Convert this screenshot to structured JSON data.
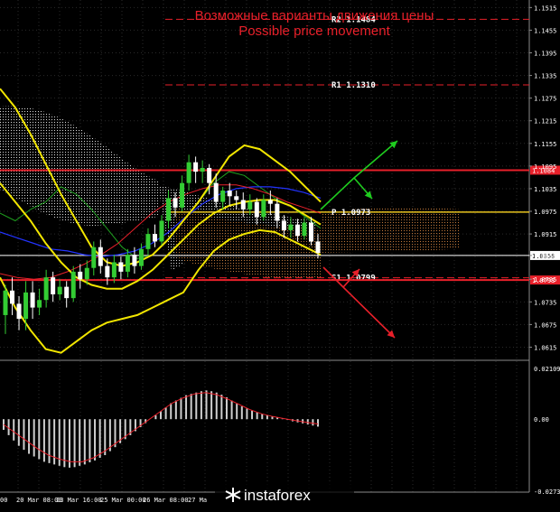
{
  "header": {
    "title_ru": "Возможные варианты движения цены",
    "title_en": "Possible price movement"
  },
  "colors": {
    "background": "#000000",
    "level_red": "#e8202a",
    "pivot_yellow": "#e6c21e",
    "bull_candle": "#33cc33",
    "bear_candle": "#ffffff",
    "bollinger": "#f2e600",
    "blue_ma": "#2233ff",
    "green_line": "#1fa01f",
    "red_ma": "#e8202a",
    "cloud_white": "#d9d9d9",
    "cloud_orange": "#c0783a",
    "arrow_up": "#1fcc1f",
    "arrow_down": "#e8202a",
    "macd_bar": "#cfcfcf",
    "signal": "#e8202a"
  },
  "chart_data": {
    "type": "candlestick",
    "price_axis": {
      "ylim": [
        1.0585,
        1.1535
      ],
      "ticks": [
        "1.1515",
        "1.1455",
        "1.1395",
        "1.1335",
        "1.1275",
        "1.1215",
        "1.1155",
        "1.1095",
        "1.1035",
        "1.0975",
        "1.0915",
        "1.0858",
        "1.0795",
        "1.0735",
        "1.0675",
        "1.0615"
      ]
    },
    "time_axis": {
      "labels": [
        "00",
        "20 Mar 08:00",
        "23 Mar 16:00",
        "25 Mar 00:00",
        "26 Mar 08:00",
        "27 Ma"
      ]
    },
    "levels": [
      {
        "name": "R2",
        "label": "R2 1.1484",
        "value": 1.1484,
        "style": "dash",
        "color": "#e8202a"
      },
      {
        "name": "R1",
        "label": "R1 1.1310",
        "value": 1.131,
        "style": "dash",
        "color": "#e8202a"
      },
      {
        "name": "resistance",
        "label": "1.1084",
        "value": 1.1084,
        "style": "solid",
        "color": "#e8202a"
      },
      {
        "name": "P",
        "label": "P 1.0973",
        "value": 1.0973,
        "style": "solid",
        "color": "#e6c21e"
      },
      {
        "name": "current",
        "label": "1.0858",
        "value": 1.0858,
        "style": "thin",
        "color": "#ffffff"
      },
      {
        "name": "S1",
        "label": "S1 1.0799",
        "value": 1.0799,
        "style": "dash",
        "color": "#e8202a"
      },
      {
        "name": "support",
        "label": "1.0793",
        "value": 1.0793,
        "style": "solid",
        "color": "#e8202a"
      }
    ],
    "candles": [
      [
        1.07,
        1.0765,
        1.065,
        1.078
      ],
      [
        1.0765,
        1.073,
        1.07,
        1.08
      ],
      [
        1.073,
        1.069,
        1.066,
        1.075
      ],
      [
        1.069,
        1.076,
        1.066,
        1.079
      ],
      [
        1.076,
        1.072,
        1.069,
        1.079
      ],
      [
        1.072,
        1.074,
        1.07,
        1.077
      ],
      [
        1.074,
        1.08,
        1.072,
        1.082
      ],
      [
        1.08,
        1.0755,
        1.0735,
        1.0815
      ],
      [
        1.0755,
        1.0775,
        1.074,
        1.0795
      ],
      [
        1.0775,
        1.0745,
        1.072,
        1.079
      ],
      [
        1.0745,
        1.0815,
        1.0735,
        1.083
      ],
      [
        1.0815,
        1.0795,
        1.077,
        1.0835
      ],
      [
        1.0795,
        1.0825,
        1.078,
        1.0845
      ],
      [
        1.0825,
        1.088,
        1.0805,
        1.0895
      ],
      [
        1.088,
        1.083,
        1.081,
        1.09
      ],
      [
        1.083,
        1.08,
        1.078,
        1.085
      ],
      [
        1.08,
        1.084,
        1.0785,
        1.086
      ],
      [
        1.084,
        1.0815,
        1.0795,
        1.0855
      ],
      [
        1.0815,
        1.086,
        1.08,
        1.0875
      ],
      [
        1.086,
        1.083,
        1.081,
        1.088
      ],
      [
        1.083,
        1.0875,
        1.082,
        1.089
      ],
      [
        1.0875,
        1.0915,
        1.086,
        1.093
      ],
      [
        1.0915,
        1.0895,
        1.088,
        1.094
      ],
      [
        1.0895,
        1.095,
        1.0885,
        1.0965
      ],
      [
        1.095,
        1.101,
        1.093,
        1.103
      ],
      [
        1.101,
        1.0985,
        1.096,
        1.1025
      ],
      [
        1.0985,
        1.105,
        1.0975,
        1.107
      ],
      [
        1.105,
        1.1105,
        1.103,
        1.1125
      ],
      [
        1.1105,
        1.108,
        1.105,
        1.112
      ],
      [
        1.108,
        1.109,
        1.105,
        1.111
      ],
      [
        1.109,
        1.105,
        1.102,
        1.11
      ],
      [
        1.105,
        1.1,
        1.0985,
        1.1075
      ],
      [
        1.1,
        1.103,
        1.098,
        1.104
      ],
      [
        1.103,
        1.1015,
        1.099,
        1.105
      ],
      [
        1.1015,
        1.1005,
        1.098,
        1.103
      ],
      [
        1.1005,
        1.098,
        1.096,
        1.1025
      ],
      [
        1.098,
        1.1,
        1.0965,
        1.102
      ],
      [
        1.1,
        1.096,
        1.094,
        1.101
      ],
      [
        1.096,
        1.1005,
        1.095,
        1.102
      ],
      [
        1.1005,
        1.0995,
        1.0965,
        1.103
      ],
      [
        1.0995,
        1.095,
        1.093,
        1.101
      ],
      [
        1.095,
        1.0925,
        1.0905,
        1.0965
      ],
      [
        1.0925,
        1.094,
        1.0905,
        1.096
      ],
      [
        1.094,
        1.091,
        1.0895,
        1.0955
      ],
      [
        1.091,
        1.0945,
        1.09,
        1.096
      ],
      [
        1.0945,
        1.0895,
        1.0885,
        1.096
      ],
      [
        1.0895,
        1.0865,
        1.085,
        1.0915
      ]
    ],
    "bollinger_upper": [
      1.13,
      1.125,
      1.118,
      1.11,
      1.102,
      1.095,
      1.088,
      1.084,
      1.083,
      1.084,
      1.086,
      1.09,
      1.095,
      1.1,
      1.106,
      1.112,
      1.115,
      1.114,
      1.111,
      1.108,
      1.104,
      1.1
    ],
    "bollinger_middle": [
      1.105,
      1.1,
      1.095,
      1.089,
      1.084,
      1.08,
      1.078,
      1.077,
      1.077,
      1.079,
      1.082,
      1.086,
      1.09,
      1.094,
      1.097,
      1.099,
      1.1,
      1.1005,
      1.1005,
      1.099,
      1.0965,
      1.094
    ],
    "bollinger_lower": [
      1.08,
      1.072,
      1.066,
      1.061,
      1.06,
      1.063,
      1.066,
      1.068,
      1.069,
      1.07,
      1.072,
      1.074,
      1.076,
      1.082,
      1.087,
      1.09,
      1.0915,
      1.0925,
      1.092,
      1.09,
      1.088,
      1.086
    ],
    "blue_ma": [
      1.092,
      1.0905,
      1.089,
      1.0875,
      1.087,
      1.086,
      1.0855,
      1.086,
      1.087,
      1.089,
      1.092,
      1.096,
      1.0995,
      1.102,
      1.1035,
      1.104,
      1.104,
      1.1035,
      1.1025,
      1.101
    ],
    "green_line": [
      1.097,
      1.095,
      1.098,
      1.1,
      1.104,
      1.102,
      1.098,
      1.093,
      1.088,
      1.085,
      1.086,
      1.09,
      1.095,
      1.1,
      1.105,
      1.108,
      1.107,
      1.104,
      1.101,
      1.099,
      1.096,
      1.093
    ],
    "red_ma": [
      1.081,
      1.08,
      1.0795,
      1.08,
      1.0815,
      1.0835,
      1.086,
      1.089,
      1.093,
      1.097,
      1.1,
      1.102,
      1.1035,
      1.1045,
      1.1045,
      1.1035,
      1.102,
      1.1,
      1.0985,
      1.097
    ],
    "macd_axis": {
      "ticks": [
        "0.02109",
        "0.00",
        "-0.02739"
      ],
      "ylim": [
        -0.02739,
        0.02109
      ]
    },
    "macd": [
      -0.004,
      -0.006,
      -0.008,
      -0.01,
      -0.0115,
      -0.013,
      -0.014,
      -0.015,
      -0.016,
      -0.0165,
      -0.017,
      -0.0175,
      -0.018,
      -0.0182,
      -0.018,
      -0.0175,
      -0.017,
      -0.0162,
      -0.0155,
      -0.0145,
      -0.0135,
      -0.012,
      -0.0105,
      -0.009,
      -0.0075,
      -0.006,
      -0.0045,
      -0.003,
      -0.0015,
      0.0,
      0.0015,
      0.003,
      0.0045,
      0.006,
      0.007,
      0.008,
      0.009,
      0.0095,
      0.01,
      0.0105,
      0.0108,
      0.0105,
      0.01,
      0.0092,
      0.0082,
      0.007,
      0.0058,
      0.0048,
      0.004,
      0.0032,
      0.0026,
      0.002,
      0.0015,
      0.001,
      0.0006,
      0.0002,
      -0.0003,
      -0.0008,
      -0.0012,
      -0.0016,
      -0.002,
      -0.0024,
      -0.0028
    ],
    "signal": [
      -0.002,
      -0.005,
      -0.008,
      -0.011,
      -0.0135,
      -0.015,
      -0.016,
      -0.016,
      -0.0145,
      -0.012,
      -0.009,
      -0.006,
      -0.003,
      0.0,
      0.003,
      0.006,
      0.008,
      0.0095,
      0.01,
      0.0092,
      0.0075,
      0.0055,
      0.0035,
      0.002,
      0.001,
      0.0002,
      -0.0005,
      -0.0012,
      -0.0018
    ]
  },
  "watermark": {
    "text": "instaforex"
  }
}
